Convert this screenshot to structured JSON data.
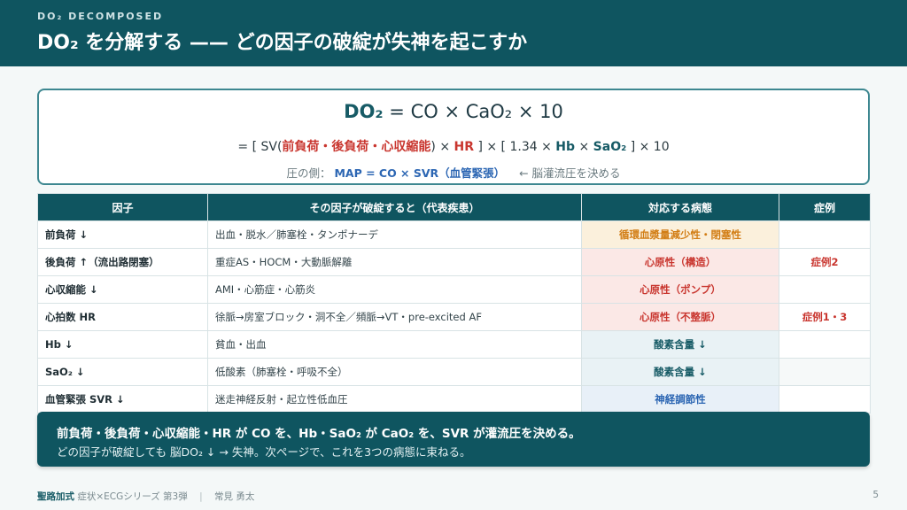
{
  "header": {
    "kicker": "DO₂ DECOMPOSED",
    "title": "DO₂ を分解する —— どの因子の破綻が失神を起こすか"
  },
  "formula": {
    "main_lhs": "DO₂",
    "main_rhs": " = CO × CaO₂ × 10",
    "expand": {
      "p1": "= [ SV(",
      "preload_terms": "前負荷・後負荷・心収縮能",
      "p2": ") × ",
      "hr": "HR",
      "p3": " ] × [ 1.34 × ",
      "hb": "Hb",
      "p4": " × ",
      "sao2": "SaO₂",
      "p5": " ] × 10"
    },
    "note": {
      "label": "圧の側：",
      "map": "MAP = CO × SVR（血管緊張）",
      "arrow_text": "← 脳灌流圧を決める"
    }
  },
  "table": {
    "headers": [
      "因子",
      "その因子が破綻すると（代表疾患）",
      "対応する病態",
      "症例"
    ],
    "rows": [
      {
        "factor": "前負荷 ↓",
        "cause": "出血・脱水／肺塞栓・タンポナーデ",
        "state": "循環血漿量減少性・閉塞性",
        "case": ""
      },
      {
        "factor": "後負荷 ↑（流出路閉塞）",
        "cause": "重症AS・HOCM・大動脈解離",
        "state": "心原性（構造）",
        "case": "症例2"
      },
      {
        "factor": "心収縮能 ↓",
        "cause": "AMI・心筋症・心筋炎",
        "state": "心原性（ポンプ）",
        "case": ""
      },
      {
        "factor": "心拍数 HR",
        "cause": "徐脈→房室ブロック・洞不全／頻脈→VT・pre-excited AF",
        "state": "心原性（不整脈）",
        "case": "症例1・3"
      },
      {
        "factor": "Hb ↓",
        "cause": "貧血・出血",
        "state": "酸素含量 ↓",
        "case": ""
      },
      {
        "factor": "SaO₂ ↓",
        "cause": "低酸素（肺塞栓・呼吸不全）",
        "state": "酸素含量 ↓",
        "case": ""
      },
      {
        "factor": "血管緊張 SVR ↓",
        "cause": "迷走神経反射・起立性低血圧",
        "state": "神経調節性",
        "case": ""
      }
    ]
  },
  "colors": {
    "state_orange_bg": "#fbf0dc",
    "state_orange_fg": "#d27d14",
    "state_red_bg": "#fbe8e6",
    "state_red_fg": "#c9362f",
    "state_teal_bg": "#e9f2f5",
    "state_teal_fg": "#175b66",
    "state_blue_bg": "#e8f0f8",
    "state_blue_fg": "#2c66b3"
  },
  "summary": {
    "line1": "前負荷・後負荷・心収縮能・HR が CO を、Hb・SaO₂ が CaO₂ を、SVR が灌流圧を決める。",
    "line2": "どの因子が破綻しても 脳DO₂ ↓ → 失神。次ページで、これを3つの病態に束ねる。"
  },
  "footer": {
    "brand": "聖路加式",
    "series": "症状×ECGシリーズ 第3弾",
    "author": "常見 勇太",
    "page": "5"
  }
}
